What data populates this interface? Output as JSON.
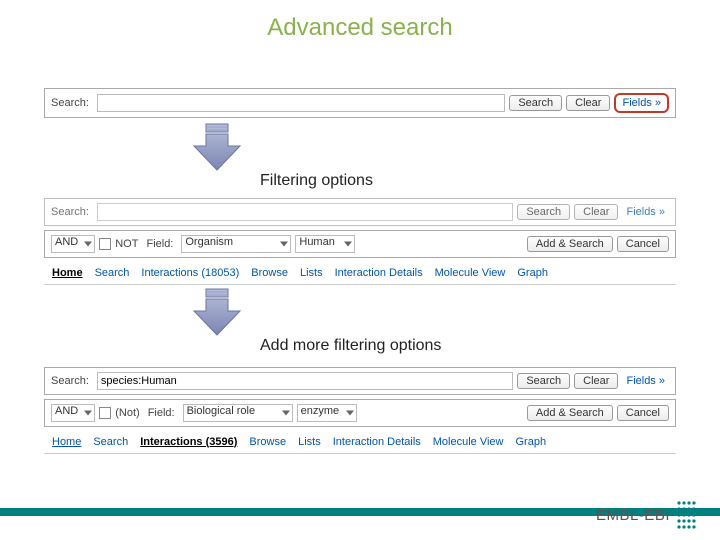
{
  "title": "Advanced search",
  "labels": {
    "filtering": "Filtering options",
    "addmore": "Add more filtering options"
  },
  "panel1": {
    "searchLabel": "Search:",
    "searchBtn": "Search",
    "clearBtn": "Clear",
    "fields": "Fields »"
  },
  "panel2a": {
    "searchLabel": "Search:",
    "searchBtn": "Search",
    "clearBtn": "Clear",
    "fields": "Fields »"
  },
  "panel2b": {
    "and": "AND",
    "notLabel": "NOT",
    "fieldLabel": "Field:",
    "fieldValue": "Organism",
    "human": "Human",
    "addSearch": "Add & Search",
    "cancel": "Cancel"
  },
  "tabs1": {
    "items": [
      "Home",
      "Search",
      "Interactions (18053)",
      "Browse",
      "Lists",
      "Interaction Details",
      "Molecule View",
      "Graph"
    ],
    "activeIndex": 0
  },
  "panel3a": {
    "searchLabel": "Search:",
    "searchValue": "species:Human",
    "searchBtn": "Search",
    "clearBtn": "Clear",
    "fields": "Fields »"
  },
  "panel3b": {
    "and": "AND",
    "notLabel": "(Not)",
    "fieldLabel": "Field:",
    "fieldValue": "Biological role",
    "enzyme": "enzyme",
    "addSearch": "Add & Search",
    "cancel": "Cancel"
  },
  "tabs2": {
    "items": [
      "Home",
      "Search",
      "Interactions (3596)",
      "Browse",
      "Lists",
      "Interaction Details",
      "Molecule View",
      "Graph"
    ],
    "activeIndex": 2
  },
  "footer": {
    "brand": "EMBL-EBI"
  }
}
